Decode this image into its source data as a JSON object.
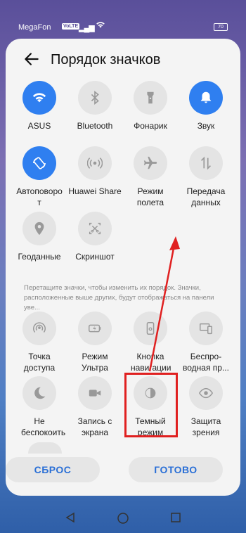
{
  "status": {
    "carrier": "MegaFon",
    "network": "VoLTE",
    "battery": "70"
  },
  "header": {
    "title": "Порядок значков"
  },
  "active_tiles": [
    {
      "label": "ASUS",
      "icon": "wifi-icon",
      "on": true
    },
    {
      "label": "Bluetooth",
      "icon": "bluetooth-icon",
      "on": false
    },
    {
      "label": "Фонарик",
      "icon": "flashlight-icon",
      "on": false
    },
    {
      "label": "Звук",
      "icon": "bell-icon",
      "on": true
    },
    {
      "label": "Автоповорот",
      "icon": "rotate-icon",
      "on": true
    },
    {
      "label": "Huawei Share",
      "icon": "share-icon",
      "on": false
    },
    {
      "label": "Режим полета",
      "icon": "airplane-icon",
      "on": false
    },
    {
      "label": "Передача данных",
      "icon": "data-icon",
      "on": false
    },
    {
      "label": "Геоданные",
      "icon": "location-icon",
      "on": false
    },
    {
      "label": "Скриншот",
      "icon": "screenshot-icon",
      "on": false
    }
  ],
  "hint": "Перетащите значки, чтобы изменить их порядок. Значки, расположенные выше других, будут отображаться на панели уве...",
  "inactive_tiles": [
    {
      "label": "Точка доступа",
      "icon": "hotspot-icon"
    },
    {
      "label": "Режим Ультра",
      "icon": "battery-saver-icon"
    },
    {
      "label": "Кнопка навигации",
      "icon": "nav-button-icon"
    },
    {
      "label": "Беспро-водная пр...",
      "icon": "wireless-projection-icon"
    },
    {
      "label": "Не беспокоить",
      "icon": "moon-icon"
    },
    {
      "label": "Запись с экрана",
      "icon": "screen-record-icon"
    },
    {
      "label": "Темный режим",
      "icon": "dark-mode-icon"
    },
    {
      "label": "Защита зрения",
      "icon": "eye-icon"
    }
  ],
  "buttons": {
    "reset": "СБРОС",
    "done": "ГОТОВО"
  },
  "colors": {
    "accent": "#2f7ff0",
    "highlight": "#e02020"
  }
}
